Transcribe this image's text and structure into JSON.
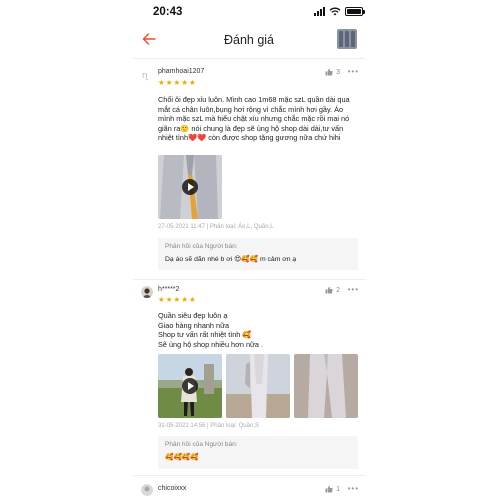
{
  "status_bar": {
    "time": "20:43"
  },
  "header": {
    "title": "Đánh giá"
  },
  "reviews": [
    {
      "user": "phamhoai1207",
      "likes": "3",
      "more": "•••",
      "stars": 5,
      "text": "Chổi ôi đẹp xỉu luôn. Mình cao 1m68 mặc szL quần dài qua mắt cá chân luôn,bụng hơi rộng vì chắc mình hơi gầy. Áo mình mặc szL mà hiểu chật xíu nhưng chắc mặc rồi mai nó giãn ra🙂 nói chung là đẹp sẽ ủng hộ shop dài dài,tư vấn nhiệt tình❤️❤️ còn được shop tặng gương nữa chứ hihi",
      "meta": "27-05-2021 11:47 | Phân loại: Áo,L, Quần,L",
      "reply_label": "Phản hồi của Người bán:",
      "reply_text": "Dạ áo sẽ dãn nhé b ơi 😍🥰🥰 m cảm ơn ạ"
    },
    {
      "user": "h*****2",
      "likes": "2",
      "more": "•••",
      "stars": 5,
      "text": "Quần siêu đẹp luôn ạ\nGiao hàng nhanh nữa\nShop tư vấn rất nhiệt tình 🥰\nSẽ ủng hộ shop nhiều hơn nữa .",
      "meta": "31-05-2021 14:56 | Phân loại: Quần,S",
      "reply_label": "Phản hồi của Người bán:",
      "reply_text": "🥰🥰🥰🥰"
    },
    {
      "user": "chicoixxx",
      "likes": "1",
      "more": "•••"
    }
  ],
  "colors": {
    "accent": "#ee4d2d",
    "star": "#f6a700"
  }
}
